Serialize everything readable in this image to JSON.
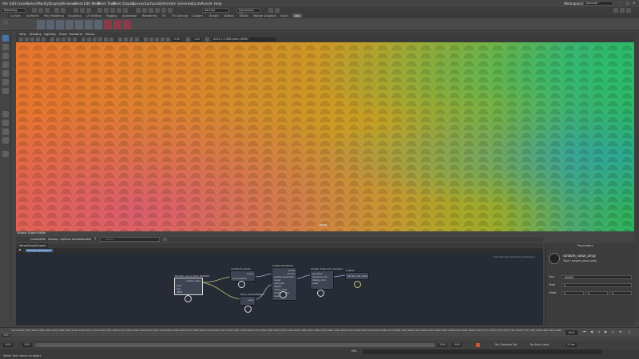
{
  "menubar": {
    "items": [
      "File",
      "Edit",
      "Create",
      "Select",
      "Modify",
      "Display",
      "Windows",
      "Mesh",
      "Edit Mesh",
      "Mesh Tools",
      "Mesh Display",
      "Curves",
      "Surfaces",
      "Deform",
      "UV",
      "Generate",
      "Cache",
      "Arnold",
      "Help"
    ],
    "workspace_label": "Workspace:",
    "workspace_value": "General*"
  },
  "statusline": {
    "mode": "Modeling",
    "live_surface": "No Live Surface",
    "symmetry": "Symmetry: Off"
  },
  "shelf_tabs": [
    "Curves",
    "Surfaces",
    "Poly Modeling",
    "Sculpting",
    "UV Editing",
    "Rigging",
    "Animation",
    "Rendering",
    "FX",
    "FX Caching",
    "Custom",
    "Arnold",
    "Bifrost",
    "MASH",
    "Motion Graphics",
    "XGen",
    "alip"
  ],
  "active_shelf_tab": "alip",
  "viewport": {
    "menu": [
      "View",
      "Shading",
      "Lighting",
      "Show",
      "Renderer",
      "Panels"
    ],
    "gamma": "0.00",
    "exposure": "1.00",
    "colorspace": "ACES 1.0 SDR-video (sRGB)",
    "camera_label": "persp"
  },
  "bifrost": {
    "title": "Bifrost Graph Editor",
    "menu": [
      "Create",
      "Edit",
      "Display",
      "Options",
      "Windows",
      "Help"
    ],
    "search_placeholder": "Search...",
    "tab": "bifrostGraphShape1",
    "path": "bifrostGraphShape1",
    "graph_path": "/bifrostGraph1/bifrostGraphShape1",
    "nodes": {
      "random": {
        "title": "Random array (Size 100000)",
        "ports": [
          "random_value",
          "seed",
          "size",
          "offset"
        ]
      },
      "construct": {
        "title": "construct_points",
        "ports": [
          "points",
          "point_position"
        ]
      },
      "create_volume": {
        "title": "create_fmVolume",
        "ports": [
          "points",
          "volume",
          "position_generation",
          "render",
          "voxel_size",
          "dilation",
          "radius_scale",
          "rendered_color",
          "resolution",
          "unpack"
        ]
      },
      "merge": {
        "title": "merge_dragoncls_mesh(n)",
        "ports": [
          "geometry",
          "rendered_color",
          "display_color",
          "value",
          "render_color"
        ]
      },
      "output": {
        "title": "output",
        "ports": [
          "bifrost_node_output"
        ]
      },
      "turbulence": {
        "title": "Turbu_lemD/Shape1",
        "ports": [
          "value"
        ]
      }
    }
  },
  "parameters": {
    "header": "Parameters",
    "node_name": "random_value_array",
    "node_type": "Type: random_value_array",
    "size_label": "Size",
    "size_value": "100000",
    "seed_label": "Seed",
    "seed_value": "0",
    "offset_label": "Offset",
    "offset_values": [
      "0",
      "0",
      "0"
    ]
  },
  "timeline": {
    "ticks": [
      "1010",
      "1020",
      "1030",
      "1040",
      "1050",
      "1060",
      "1070",
      "1080",
      "1090",
      "1100",
      "1110",
      "1120",
      "1130",
      "1140",
      "1150",
      "1160",
      "1170",
      "1180",
      "1190",
      "1200",
      "1210",
      "1220",
      "1230",
      "1240",
      "1250",
      "1260",
      "1270",
      "1280",
      "1290",
      "1300",
      "1310",
      "1320",
      "1330",
      "1340",
      "1350",
      "1360",
      "1370",
      "1380",
      "1390",
      "1400",
      "1410",
      "1420",
      "1430",
      "1440",
      "1450",
      "1460",
      "1470",
      "1480",
      "1490",
      "1500",
      "1510",
      "1520",
      "1530",
      "1540",
      "1550",
      "1560",
      "1570",
      "1580",
      "1590",
      "1600",
      "1610",
      "1620",
      "1630",
      "1640",
      "1650",
      "1660",
      "1670",
      "1680",
      "1690",
      "1700",
      "1710",
      "1720",
      "1730",
      "1740",
      "1750",
      "1760",
      "1770",
      "1780",
      "1790",
      "1800",
      "1810",
      "1820"
    ],
    "current_frame": "1001",
    "start": "1001",
    "range_start": "1001",
    "range_end": "3500",
    "end": "3500",
    "char_set": "No Character Set",
    "anim_layer": "No Anim Layer",
    "fps": "24 fps"
  },
  "cmdline": {
    "label": "MEL"
  },
  "helpline": {
    "text": "Select Tool: select an object"
  }
}
